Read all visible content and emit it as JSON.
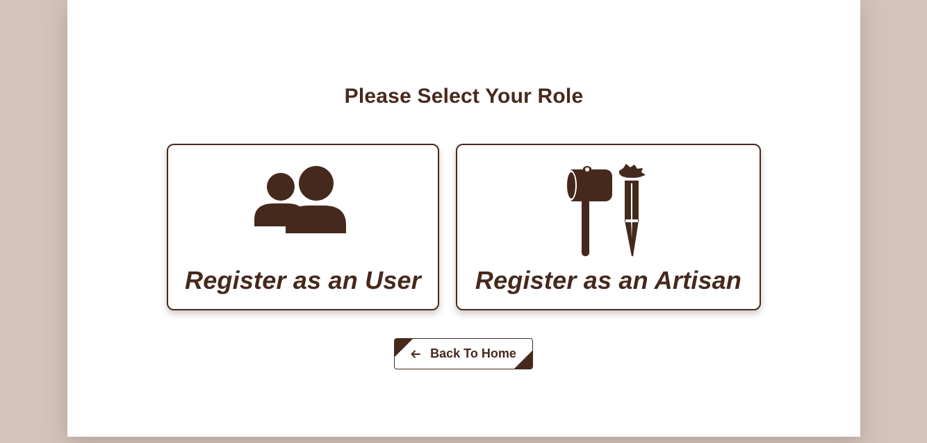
{
  "page": {
    "title": "Please Select Your Role"
  },
  "roles": [
    {
      "label": "Register as an User",
      "icon": "users-icon"
    },
    {
      "label": "Register as an Artisan",
      "icon": "hammer-chisel-icon"
    }
  ],
  "back_button": {
    "label": "Back To Home",
    "icon": "arrow-left-icon"
  },
  "colors": {
    "accent": "#46291d",
    "background": "#d3c3bb",
    "panel": "#ffffff"
  }
}
